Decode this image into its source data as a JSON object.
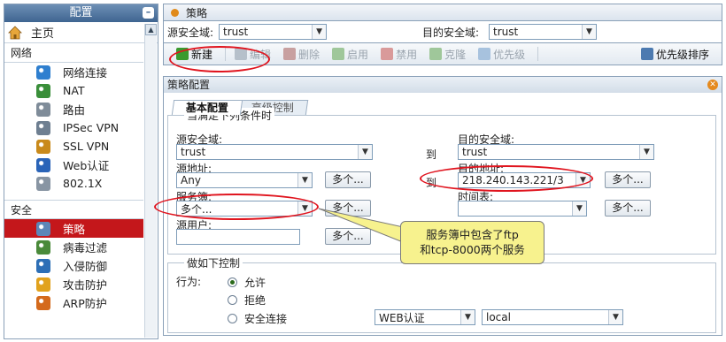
{
  "sidebar": {
    "title": "配置",
    "collapse_symbol": "–",
    "home": {
      "label": "主页",
      "icon": "home-icon"
    },
    "groups": [
      {
        "label": "网络",
        "items": [
          {
            "label": "网络连接",
            "icon": "globe-icon",
            "color": "#2f7fcf"
          },
          {
            "label": "NAT",
            "icon": "globe-icon",
            "color": "#3a8f3a"
          },
          {
            "label": "路由",
            "icon": "router-icon",
            "color": "#7f8c99"
          },
          {
            "label": "IPSec VPN",
            "icon": "vpn-grid-icon",
            "color": "#6e7f91"
          },
          {
            "label": "SSL VPN",
            "icon": "ssl-icon",
            "color": "#c98a1b"
          },
          {
            "label": "Web认证",
            "icon": "globe-icon",
            "color": "#2a64b8"
          },
          {
            "label": "802.1X",
            "icon": "network-icon",
            "color": "#8895a3"
          }
        ]
      },
      {
        "label": "安全",
        "items": [
          {
            "label": "策略",
            "icon": "policy-icon",
            "color": "#5c86b8",
            "active": true
          },
          {
            "label": "病毒过滤",
            "icon": "virus-icon",
            "color": "#4a8a3a"
          },
          {
            "label": "入侵防御",
            "icon": "intrusion-icon",
            "color": "#2d6fb6"
          },
          {
            "label": "攻击防护",
            "icon": "shield-icon",
            "color": "#e1a21d"
          },
          {
            "label": "ARP防护",
            "icon": "arp-icon",
            "color": "#d46a1c"
          }
        ]
      }
    ]
  },
  "main": {
    "tab_title": "策略",
    "filter": {
      "src_label": "源安全域:",
      "src_value": "trust",
      "dst_label": "目的安全域:",
      "dst_value": "trust"
    },
    "toolbar": [
      {
        "label": "新建",
        "icon": "new-icon",
        "enabled": true,
        "color": "#3a9a2e"
      },
      {
        "label": "编辑",
        "icon": "edit-icon",
        "enabled": false,
        "color": "#b6c0ca"
      },
      {
        "label": "删除",
        "icon": "trash-icon",
        "enabled": false,
        "color": "#c8a0a0"
      },
      {
        "label": "启用",
        "icon": "enable-icon",
        "enabled": false,
        "color": "#9fc79a"
      },
      {
        "label": "禁用",
        "icon": "disable-icon",
        "enabled": false,
        "color": "#d99a9a"
      },
      {
        "label": "克隆",
        "icon": "clone-icon",
        "enabled": false,
        "color": "#9fc79a"
      },
      {
        "label": "优先级",
        "icon": "priority-icon",
        "enabled": false,
        "color": "#a7c2de"
      },
      {
        "label": "优先级排序",
        "icon": "sort-icon",
        "enabled": true,
        "color": "#4c7ab0"
      }
    ]
  },
  "config": {
    "title": "策略配置",
    "tabs": [
      {
        "label": "基本配置",
        "active": true
      },
      {
        "label": "高级控制",
        "active": false
      }
    ],
    "conditions_legend": "当满足下列条件时",
    "src_zone_label": "源安全域:",
    "src_zone_value": "trust",
    "to_label": "到",
    "dst_zone_label": "目的安全域:",
    "dst_zone_value": "trust",
    "src_addr_label": "源地址:",
    "src_addr_value": "Any",
    "multi_button": "多个...",
    "dst_addr_label": "目的地址:",
    "dst_addr_value": "218.240.143.221/3",
    "service_label": "服务簿:",
    "service_value": "多个...",
    "time_label": "时间表:",
    "time_value": "",
    "src_user_label": "源用户:",
    "src_user_value": "",
    "action_legend": "做如下控制",
    "action_label": "行为:",
    "actions": [
      {
        "label": "允许",
        "selected": true
      },
      {
        "label": "拒绝",
        "selected": false
      },
      {
        "label": "安全连接",
        "selected": false
      }
    ],
    "secure_auth_value": "WEB认证",
    "secure_local_value": "local"
  },
  "annotation": {
    "callout_line1": "服务簿中包含了ftp",
    "callout_line2": "和tcp-8000两个服务"
  }
}
